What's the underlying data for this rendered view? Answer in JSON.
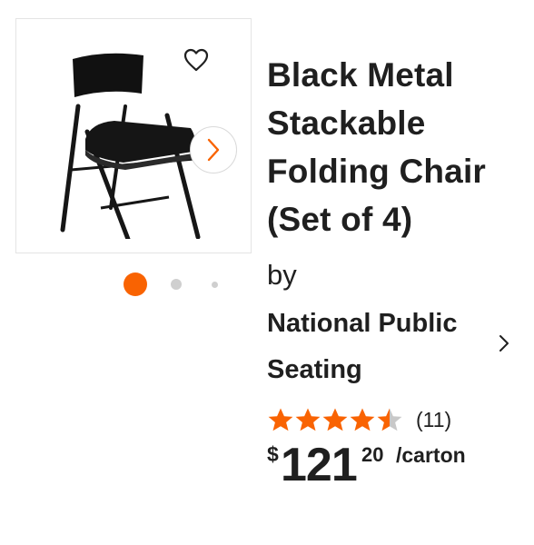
{
  "product": {
    "title_lines": [
      "Black Metal",
      "Stackable",
      "Folding Chair",
      "(Set of 4)"
    ],
    "by_label": "by",
    "brand_lines": [
      "National Public",
      "Seating"
    ],
    "rating": {
      "value": 4.5,
      "max": 5,
      "count_label": "(11)"
    },
    "price": {
      "currency": "$",
      "dollars": "121",
      "cents": "20",
      "unit": "/carton"
    }
  },
  "gallery": {
    "image_count": 3,
    "active_index": 0
  },
  "colors": {
    "accent": "#f96302",
    "star_filled": "#f96302",
    "star_empty": "#c8c8c8",
    "text": "#1f1f1f"
  },
  "icons": {
    "favorite": "heart-outline-icon",
    "next": "chevron-right-icon",
    "brand_link": "chevron-right-icon",
    "rating": "star-icon"
  }
}
